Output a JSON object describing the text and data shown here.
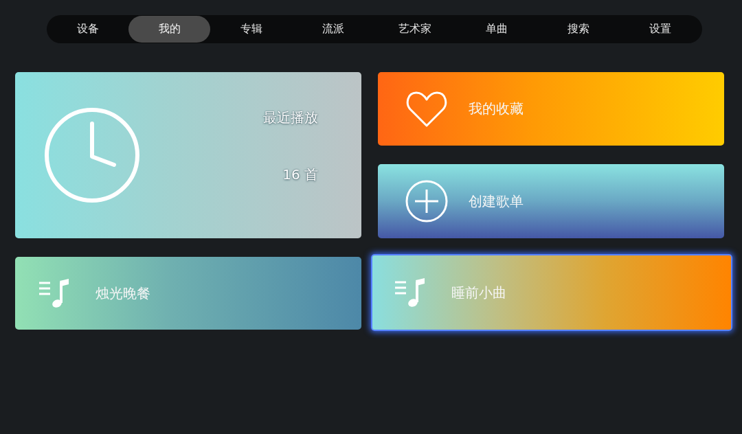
{
  "tabs": [
    {
      "label": "设备",
      "selected": false
    },
    {
      "label": "我的",
      "selected": true
    },
    {
      "label": "专辑",
      "selected": false
    },
    {
      "label": "流派",
      "selected": false
    },
    {
      "label": "艺术家",
      "selected": false
    },
    {
      "label": "单曲",
      "selected": false
    },
    {
      "label": "搜索",
      "selected": false
    },
    {
      "label": "设置",
      "selected": false
    }
  ],
  "cards": [
    {
      "kind": "recent",
      "title": "最近播放",
      "count": "16 首",
      "selected": false
    },
    {
      "kind": "favorites",
      "title": "我的收藏",
      "selected": false
    },
    {
      "kind": "create",
      "title": "创建歌单",
      "selected": false
    },
    {
      "kind": "playlist",
      "title": "烛光晚餐",
      "selected": false
    },
    {
      "kind": "playlist",
      "title": "睡前小曲",
      "selected": true
    }
  ]
}
